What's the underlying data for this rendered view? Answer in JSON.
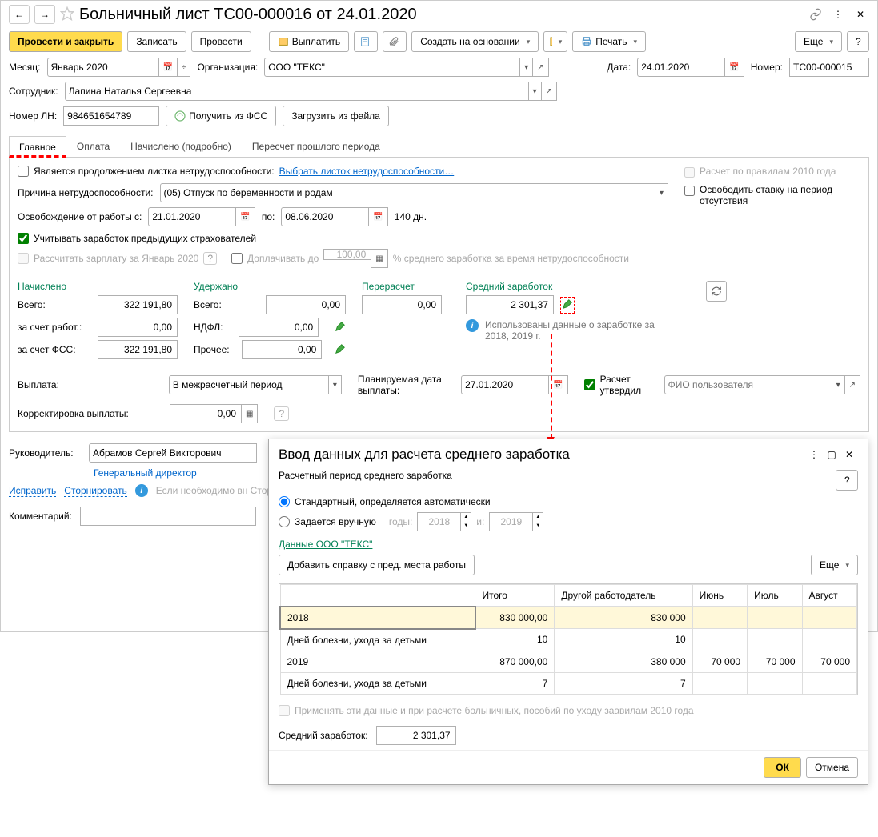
{
  "header": {
    "title": "Больничный лист ТС00-000016 от 24.01.2020"
  },
  "toolbar": {
    "post_close": "Провести и закрыть",
    "save": "Записать",
    "post": "Провести",
    "pay": "Выплатить",
    "create_based": "Создать на основании",
    "print": "Печать",
    "more": "Еще",
    "help": "?"
  },
  "form": {
    "month_label": "Месяц:",
    "month_value": "Январь 2020",
    "org_label": "Организация:",
    "org_value": "ООО \"ТЕКС\"",
    "date_label": "Дата:",
    "date_value": "24.01.2020",
    "number_label": "Номер:",
    "number_value": "ТС00-000015",
    "employee_label": "Сотрудник:",
    "employee_value": "Лапина Наталья Сергеевна",
    "ln_label": "Номер ЛН:",
    "ln_value": "984651654789",
    "get_fss": "Получить из ФСС",
    "load_file": "Загрузить из файла"
  },
  "tabs": {
    "main": "Главное",
    "payment": "Оплата",
    "accrued": "Начислено (подробно)",
    "recalc": "Пересчет прошлого периода"
  },
  "main_tab": {
    "continuation_label": "Является продолжением листка нетрудоспособности:",
    "choose_sheet": "Выбрать листок нетрудоспособности…",
    "reason_label": "Причина нетрудоспособности:",
    "reason_value": "(05) Отпуск по беременности и родам",
    "rule2010": "Расчет по правилам 2010 года",
    "release_rate": "Освободить ставку на период отсутствия",
    "release_label": "Освобождение от работы с:",
    "date_from": "21.01.2020",
    "to_label": "по:",
    "date_to": "08.06.2020",
    "days": "140 дн.",
    "prev_insurers": "Учитывать заработок предыдущих страхователей",
    "calc_salary": "Рассчитать зарплату за Январь 2020",
    "topup_label": "Доплачивать до",
    "topup_value": "100,00",
    "topup_suffix": "% среднего заработка за время нетрудоспособности",
    "accrued_header": "Начислено",
    "total_label": "Всего:",
    "accrued_total": "322 191,80",
    "employer_label": "за счет работ.:",
    "employer_val": "0,00",
    "fss_label": "за счет ФСС:",
    "fss_val": "322 191,80",
    "withheld_header": "Удержано",
    "withheld_total": "0,00",
    "ndfl_label": "НДФЛ:",
    "ndfl_val": "0,00",
    "other_label": "Прочее:",
    "other_val": "0,00",
    "recalc_header": "Перерасчет",
    "recalc_val": "0,00",
    "avg_header": "Средний заработок",
    "avg_val": "2 301,37",
    "info_text": "Использованы данные о заработке за 2018, 2019 г.",
    "payout_label": "Выплата:",
    "payout_value": "В межрасчетный период",
    "planned_date_label": "Планируемая дата выплаты:",
    "planned_date_value": "27.01.2020",
    "approved_label": "Расчет утвердил",
    "approved_by_placeholder": "ФИО пользователя",
    "correction_label": "Корректировка выплаты:",
    "correction_val": "0,00"
  },
  "footer": {
    "manager_label": "Руководитель:",
    "manager_value": "Абрамов Сергей Викторович",
    "manager_position": "Генеральный директор",
    "fix_link": "Исправить",
    "storno_link": "Сторнировать",
    "hint": "Если необходимо вн Сторнировать",
    "comment_label": "Комментарий:"
  },
  "modal": {
    "title": "Ввод данных для расчета среднего заработка",
    "period_label": "Расчетный период среднего заработка",
    "std_label": "Стандартный, определяется автоматически",
    "manual_label": "Задается вручную",
    "years_label": "годы:",
    "year1": "2018",
    "and_label": "и:",
    "year2": "2019",
    "data_header": "Данные ООО \"ТЕКС\"",
    "add_ref": "Добавить справку с пред. места работы",
    "more": "Еще",
    "help": "?",
    "cols": [
      "",
      "Итого",
      "Другой работодатель",
      "Июнь",
      "Июль",
      "Август"
    ],
    "rows": [
      {
        "label": "2018",
        "total": "830 000,00",
        "other": "830 000",
        "jun": "",
        "jul": "",
        "aug": "",
        "highlight": true,
        "selected": true
      },
      {
        "label": "Дней болезни, ухода за детьми",
        "total": "10",
        "other": "10",
        "jun": "",
        "jul": "",
        "aug": ""
      },
      {
        "label": "2019",
        "total": "870 000,00",
        "other": "380 000",
        "jun": "70 000",
        "jul": "70 000",
        "aug": "70 000"
      },
      {
        "label": "Дней болезни, ухода за детьми",
        "total": "7",
        "other": "7",
        "jun": "",
        "jul": "",
        "aug": ""
      }
    ],
    "apply_checkbox": "Применять эти данные и при расчете больничных, пособий по уходу заавилам 2010 года",
    "avg_label": "Средний заработок:",
    "avg_val": "2 301,37",
    "ok": "ОК",
    "cancel": "Отмена"
  }
}
